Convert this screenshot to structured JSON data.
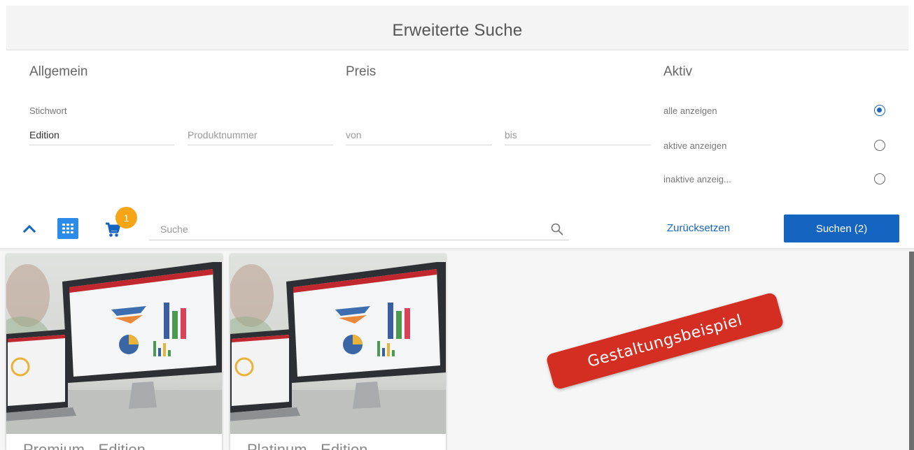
{
  "header": {
    "title": "Erweiterte Suche"
  },
  "sections": {
    "general": "Allgemein",
    "price": "Preis",
    "active": "Aktiv"
  },
  "general": {
    "keyword_label": "Stichwort",
    "keyword_value": "Edition",
    "product_number_placeholder": "Produktnummer"
  },
  "price": {
    "from_placeholder": "von",
    "to_placeholder": "bis"
  },
  "active_options": [
    {
      "label": "alle anzeigen",
      "selected": true
    },
    {
      "label": "aktive anzeigen",
      "selected": false
    },
    {
      "label": "inaktive anzeig...",
      "selected": false
    }
  ],
  "toolbar": {
    "collapse_icon": "chevron-up-icon",
    "grid_icon": "grid-view-icon",
    "cart_icon": "cart-icon",
    "cart_count": "1",
    "search_placeholder": "Suche",
    "search_icon": "search-icon",
    "reset_label": "Zurücksetzen",
    "search_button_label": "Suchen (2)"
  },
  "results": [
    {
      "title": "Premium - Edition"
    },
    {
      "title": "Platinum - Edition"
    }
  ],
  "watermark": "Gestaltungsbeispiel",
  "colors": {
    "accent": "#1565c0",
    "grid_button": "#2b8be8",
    "badge": "#f5a516",
    "stamp": "#d42e22"
  }
}
